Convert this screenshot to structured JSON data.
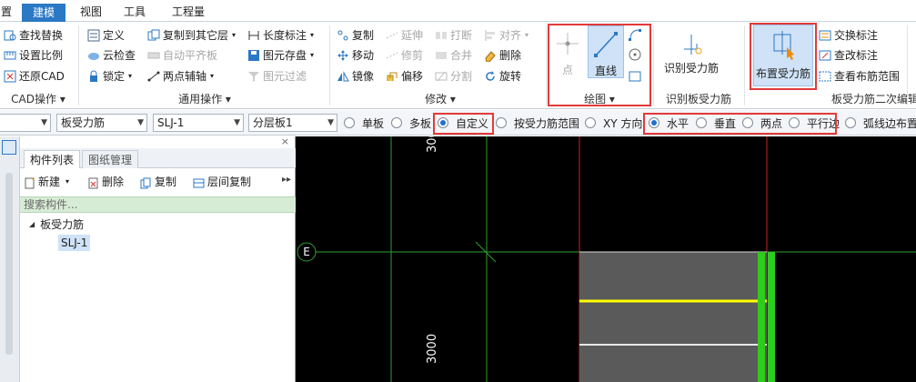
{
  "menu": {
    "items": [
      "置",
      "建模",
      "视图",
      "工具",
      "工程量"
    ],
    "active": "建模"
  },
  "cad_ops": {
    "find_replace": "查找替换",
    "set_scale": "设置比例",
    "restore_cad": "还原CAD",
    "group": "CAD操作"
  },
  "common_ops": {
    "define": "定义",
    "cloud_check": "云检查",
    "lock": "锁定",
    "copy_to_other_layer": "复制到其它层",
    "auto_flat_slab": "自动平齐板",
    "two_point_axis": "两点辅轴",
    "length_mark": "长度标注",
    "element_save": "图元存盘",
    "element_filter": "图元过滤",
    "group": "通用操作"
  },
  "modify": {
    "copy": "复制",
    "move": "移动",
    "mirror": "镜像",
    "extend": "延伸",
    "trim": "修剪",
    "offset": "偏移",
    "break": "打断",
    "merge": "合并",
    "split": "分割",
    "align": "对齐",
    "delete": "删除",
    "rotate": "旋转",
    "group": "修改"
  },
  "draw": {
    "point": "点",
    "line": "直线",
    "group": "绘图"
  },
  "identify": {
    "label": "识别受力筋",
    "group": "识别板受力筋"
  },
  "place": {
    "label": "布置受力筋"
  },
  "secondary": {
    "swap_mark": "交换标注",
    "edit_mark": "查改标注",
    "view_range": "查看布筋范围",
    "group": "板受力筋二次编辑"
  },
  "toolbar": {
    "combo0": "",
    "combo1": "板受力筋",
    "combo2": "SLJ-1",
    "combo3": "分层板1",
    "radios": [
      "单板",
      "多板",
      "自定义",
      "按受力筋范围",
      "XY 方向",
      "水平",
      "垂直",
      "两点",
      "平行边",
      "弧线边布置"
    ],
    "checked": [
      "自定义",
      "水平"
    ]
  },
  "panel": {
    "tabs": [
      "构件列表",
      "图纸管理"
    ],
    "new": "新建",
    "delete": "删除",
    "copy": "复制",
    "layer_copy": "层间复制",
    "search_placeholder": "搜索构件...",
    "tree_root": "板受力筋",
    "tree_child": "SLJ-1"
  },
  "canvas": {
    "dim_top": "3000",
    "dim_bottom": "3000",
    "axis_label": "E"
  },
  "colors": {
    "accent": "#2b78c5",
    "highlight": "#e23a3a",
    "rebar_yellow": "#ffff00",
    "rebar_green": "#2ecc1e"
  }
}
